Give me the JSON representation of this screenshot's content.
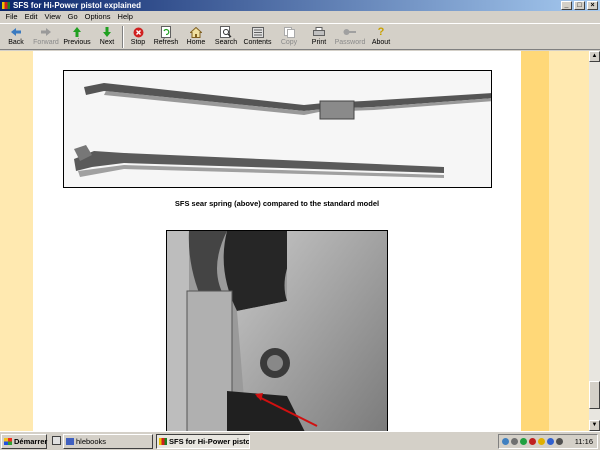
{
  "window": {
    "title": "SFS for Hi-Power pistol explained"
  },
  "menu": [
    "File",
    "Edit",
    "View",
    "Go",
    "Options",
    "Help"
  ],
  "toolbar": {
    "back": "Back",
    "forward": "Forward",
    "previous": "Previous",
    "next": "Next",
    "stop": "Stop",
    "refresh": "Refresh",
    "home": "Home",
    "search": "Search",
    "contents": "Contents",
    "copy": "Copy",
    "print": "Print",
    "password": "Password",
    "about": "About"
  },
  "content": {
    "caption": "SFS sear spring (above) compared to the standard model"
  },
  "taskbar": {
    "start": "Démarrer",
    "task1": "hlebooks",
    "task2": "SFS for Hi-Power pisto...",
    "clock": "11:16"
  },
  "colors": {
    "page_bg": "#ffe9b0",
    "stripe": "#ffd878",
    "titlebar": "#0a246a"
  }
}
